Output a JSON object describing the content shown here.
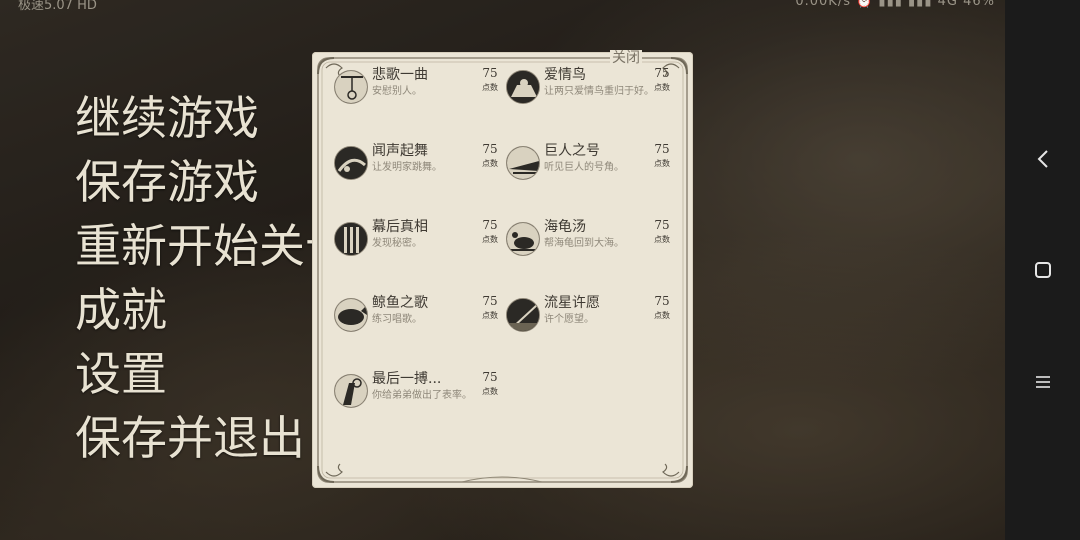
{
  "status_bar": {
    "left_text": "极速5.07 HD",
    "right_text": "0.00K/s ⏰ ▮▮▮ ▮▮▮ 4G 46%"
  },
  "pause_menu": {
    "items": [
      {
        "label": "继续游戏"
      },
      {
        "label": "保存游戏"
      },
      {
        "label": "重新开始关卡"
      },
      {
        "label": "成就"
      },
      {
        "label": "设置"
      },
      {
        "label": "保存并退出"
      }
    ]
  },
  "achievements_panel": {
    "close_label": "关闭",
    "points_unit": "点数",
    "items": [
      {
        "title": "悲歌一曲",
        "desc": "安慰别人。",
        "points": "75",
        "icon": "noose-icon"
      },
      {
        "title": "爱情鸟",
        "desc": "让两只爱情鸟重归于好。",
        "points": "75",
        "icon": "lovebirds-icon"
      },
      {
        "title": "闻声起舞",
        "desc": "让发明家跳舞。",
        "points": "75",
        "icon": "dance-icon"
      },
      {
        "title": "巨人之号",
        "desc": "听见巨人的号角。",
        "points": "75",
        "icon": "horn-icon"
      },
      {
        "title": "幕后真相",
        "desc": "发现秘密。",
        "points": "75",
        "icon": "curtain-icon"
      },
      {
        "title": "海龟汤",
        "desc": "帮海龟回到大海。",
        "points": "75",
        "icon": "turtle-icon"
      },
      {
        "title": "鲸鱼之歌",
        "desc": "练习唱歌。",
        "points": "75",
        "icon": "whale-icon"
      },
      {
        "title": "流星许愿",
        "desc": "许个愿望。",
        "points": "75",
        "icon": "shooting-star-icon"
      },
      {
        "title": "最后一搏...",
        "desc": "你给弟弟做出了表率。",
        "points": "75",
        "icon": "last-stand-icon"
      }
    ]
  },
  "navigation_bar": {
    "back_icon": "back-chevron-icon",
    "home_icon": "home-square-icon",
    "menu_icon": "menu-lines-icon"
  }
}
